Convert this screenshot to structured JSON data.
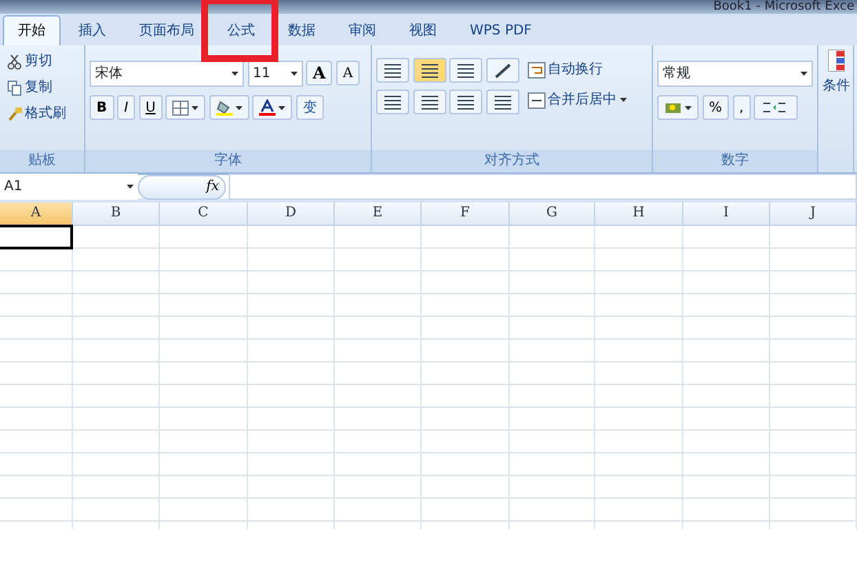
{
  "window": {
    "title": "Book1 - Microsoft Exce"
  },
  "tabs": [
    {
      "label": "开始",
      "selected": true
    },
    {
      "label": "插入",
      "selected": false
    },
    {
      "label": "页面布局",
      "selected": false
    },
    {
      "label": "公式",
      "selected": false,
      "highlighted": true
    },
    {
      "label": "数据",
      "selected": false
    },
    {
      "label": "审阅",
      "selected": false
    },
    {
      "label": "视图",
      "selected": false
    },
    {
      "label": "WPS PDF",
      "selected": false
    }
  ],
  "clipboard": {
    "items": [
      "剪切",
      "复制",
      "格式刷"
    ],
    "label": "贴板"
  },
  "font": {
    "name": "宋体",
    "size": "11",
    "grow": "A",
    "shrink": "A",
    "bold": "B",
    "italic": "I",
    "underline": "U",
    "phonetic": "变",
    "label": "字体"
  },
  "alignment": {
    "wrap": "自动换行",
    "merge": "合并后居中",
    "label": "对齐方式"
  },
  "number": {
    "format": "常规",
    "percent": "%",
    "comma": ",",
    "label": "数字"
  },
  "styles": {
    "label": "条件"
  },
  "formula_bar": {
    "name_box": "A1",
    "fx": "fx"
  },
  "columns": [
    {
      "label": "A",
      "selected": true
    },
    {
      "label": "B",
      "selected": false
    },
    {
      "label": "C",
      "selected": false
    },
    {
      "label": "D",
      "selected": false
    },
    {
      "label": "E",
      "selected": false
    },
    {
      "label": "F",
      "selected": false
    },
    {
      "label": "G",
      "selected": false
    },
    {
      "label": "H",
      "selected": false
    },
    {
      "label": "I",
      "selected": false
    },
    {
      "label": "J",
      "selected": false
    }
  ]
}
